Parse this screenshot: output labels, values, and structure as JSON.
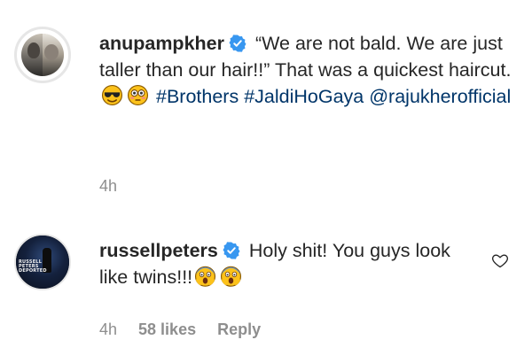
{
  "comments": [
    {
      "username": "anupampkher",
      "text_parts": {
        "quote": "“We are not bald. We are just taller than our hair!!” That was a quickest haircut.",
        "hashtag1": "#Brothers",
        "hashtag2": "#JaldiHoGaya",
        "mention": "@rajukherofficial"
      },
      "emojis": [
        "sunglasses-face-emoji",
        "flushed-face-emoji"
      ],
      "time": "4h"
    },
    {
      "username": "russellpeters",
      "text_parts": {
        "body": "Holy shit! You guys look like twins!!!"
      },
      "emojis": [
        "screaming-face-emoji",
        "screaming-face-emoji"
      ],
      "avatar_poster": {
        "line1": "RUSSELL",
        "line2": "PETERS",
        "line3": "DEPORTED"
      },
      "time": "4h",
      "likes": "58 likes",
      "reply_label": "Reply"
    }
  ],
  "colors": {
    "text": "#262626",
    "link": "#003569",
    "meta": "#8e8e8e",
    "verified": "#3897f0"
  },
  "icons": {
    "verified": "verified-badge-icon",
    "like": "heart-outline-icon"
  }
}
